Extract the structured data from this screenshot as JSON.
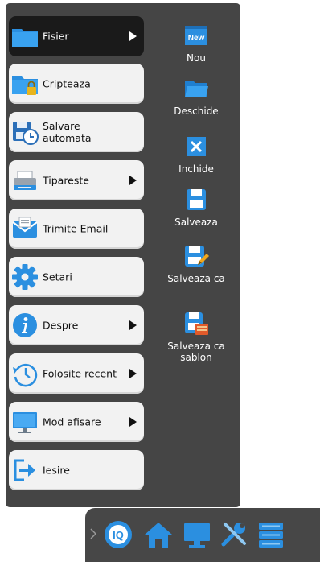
{
  "colors": {
    "panel": "#454545",
    "item_bg": "#f2f2f2",
    "item_active_bg": "#1a1a1a",
    "accent_blue": "#2b8fe0",
    "white": "#ffffff"
  },
  "menu": {
    "items": [
      {
        "label": "Fisier",
        "icon": "folder-icon",
        "has_submenu": true,
        "active": true
      },
      {
        "label": "Cripteaza",
        "icon": "locked-folder-icon",
        "has_submenu": false,
        "active": false
      },
      {
        "label": "Salvare\nautomata",
        "icon": "autosave-clock-icon",
        "has_submenu": false,
        "active": false
      },
      {
        "label": "Tipareste",
        "icon": "printer-icon",
        "has_submenu": true,
        "active": false
      },
      {
        "label": "Trimite Email",
        "icon": "email-icon",
        "has_submenu": false,
        "active": false
      },
      {
        "label": "Setari",
        "icon": "gear-icon",
        "has_submenu": false,
        "active": false
      },
      {
        "label": "Despre",
        "icon": "info-icon",
        "has_submenu": true,
        "active": false
      },
      {
        "label": "Folosite recent",
        "icon": "history-icon",
        "has_submenu": true,
        "active": false
      },
      {
        "label": "Mod afisare",
        "icon": "monitor-icon",
        "has_submenu": true,
        "active": false
      },
      {
        "label": "Iesire",
        "icon": "exit-icon",
        "has_submenu": false,
        "active": false
      }
    ]
  },
  "submenu": {
    "items": [
      {
        "label": "Nou",
        "icon": "new-document-icon",
        "badge": "New"
      },
      {
        "label": "Deschide",
        "icon": "open-folder-icon"
      },
      {
        "label": "Inchide",
        "icon": "close-icon"
      },
      {
        "label": "Salveaza",
        "icon": "save-icon"
      },
      {
        "label": "Salveaza ca",
        "icon": "save-as-icon"
      },
      {
        "label": "Salveaza ca\nsablon",
        "icon": "save-as-template-icon"
      }
    ]
  },
  "bottom_bar": {
    "icons": [
      "iq-icon",
      "home-icon",
      "monitor-icon",
      "tools-icon",
      "server-icon"
    ]
  }
}
